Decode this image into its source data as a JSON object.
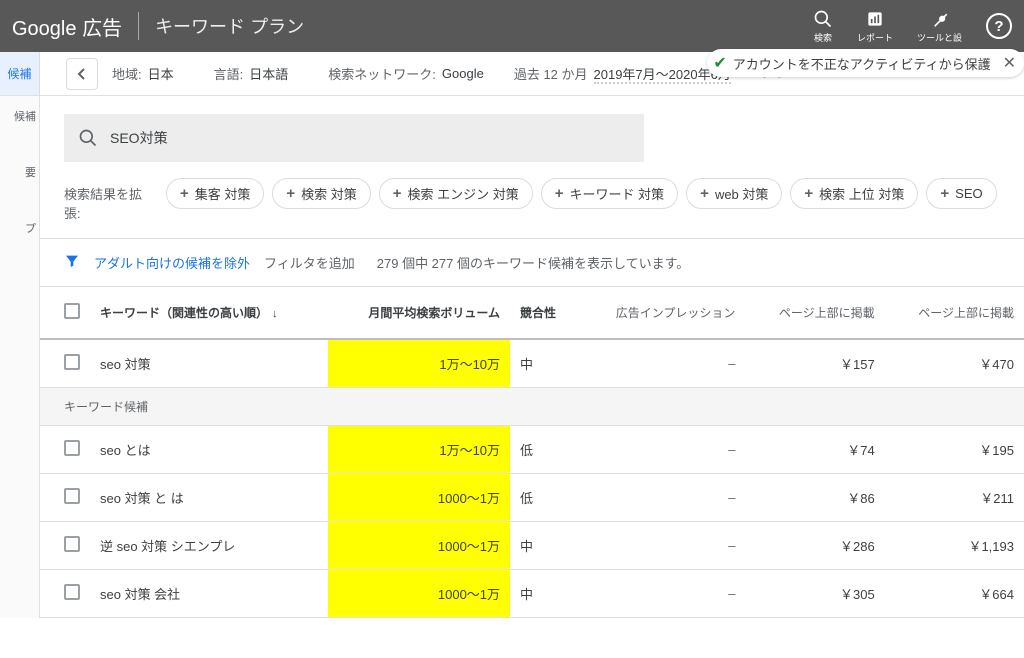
{
  "header": {
    "logo_prefix": "Google",
    "logo_suffix": "広告",
    "title": "キーワード プラン",
    "tools": {
      "search": "検索",
      "report": "レポート",
      "tools": "ツールと設"
    }
  },
  "protection_banner": {
    "text": "アカウントを不正なアクティビティから保護"
  },
  "filter_row": {
    "region_label": "地域:",
    "region_value": "日本",
    "lang_label": "言語:",
    "lang_value": "日本語",
    "network_label": "検索ネットワーク:",
    "network_value": "Google",
    "date_prefix": "過去 12 か月",
    "date_value": "2019年7月～2020年6月"
  },
  "left_nav": {
    "item1": "候補",
    "item2": "候補",
    "item3": "要",
    "item4": "プ"
  },
  "search": {
    "query": "SEO対策"
  },
  "expand": {
    "label": "検索結果を拡張:",
    "chips": [
      "集客 対策",
      "検索 対策",
      "検索 エンジン 対策",
      "キーワード 対策",
      "web 対策",
      "検索 上位 対策",
      "SEO"
    ]
  },
  "filter_info": {
    "exclude": "アダルト向けの候補を除外",
    "add_filter": "フィルタを追加",
    "count_text": "279 個中 277 個のキーワード候補を表示しています。"
  },
  "table": {
    "headers": {
      "keyword": "キーワード（関連性の高い順）",
      "volume": "月間平均検索ボリューム",
      "competition": "競合性",
      "impressions": "広告インプレッション",
      "top_low": "ページ上部に掲載",
      "top_high": "ページ上部に掲載"
    },
    "section_label": "キーワード候補",
    "rows": [
      {
        "keyword": "seo 対策",
        "volume": "1万～10万",
        "competition": "中",
        "impressions": "–",
        "bid_low": "￥157",
        "bid_high": "￥470"
      },
      {
        "keyword": "seo とは",
        "volume": "1万～10万",
        "competition": "低",
        "impressions": "–",
        "bid_low": "￥74",
        "bid_high": "￥195"
      },
      {
        "keyword": "seo 対策 と は",
        "volume": "1000～1万",
        "competition": "低",
        "impressions": "–",
        "bid_low": "￥86",
        "bid_high": "￥211"
      },
      {
        "keyword": "逆 seo 対策 シエンプレ",
        "volume": "1000～1万",
        "competition": "中",
        "impressions": "–",
        "bid_low": "￥286",
        "bid_high": "￥1,193"
      },
      {
        "keyword": "seo 対策 会社",
        "volume": "1000～1万",
        "competition": "中",
        "impressions": "–",
        "bid_low": "￥305",
        "bid_high": "￥664"
      }
    ]
  }
}
